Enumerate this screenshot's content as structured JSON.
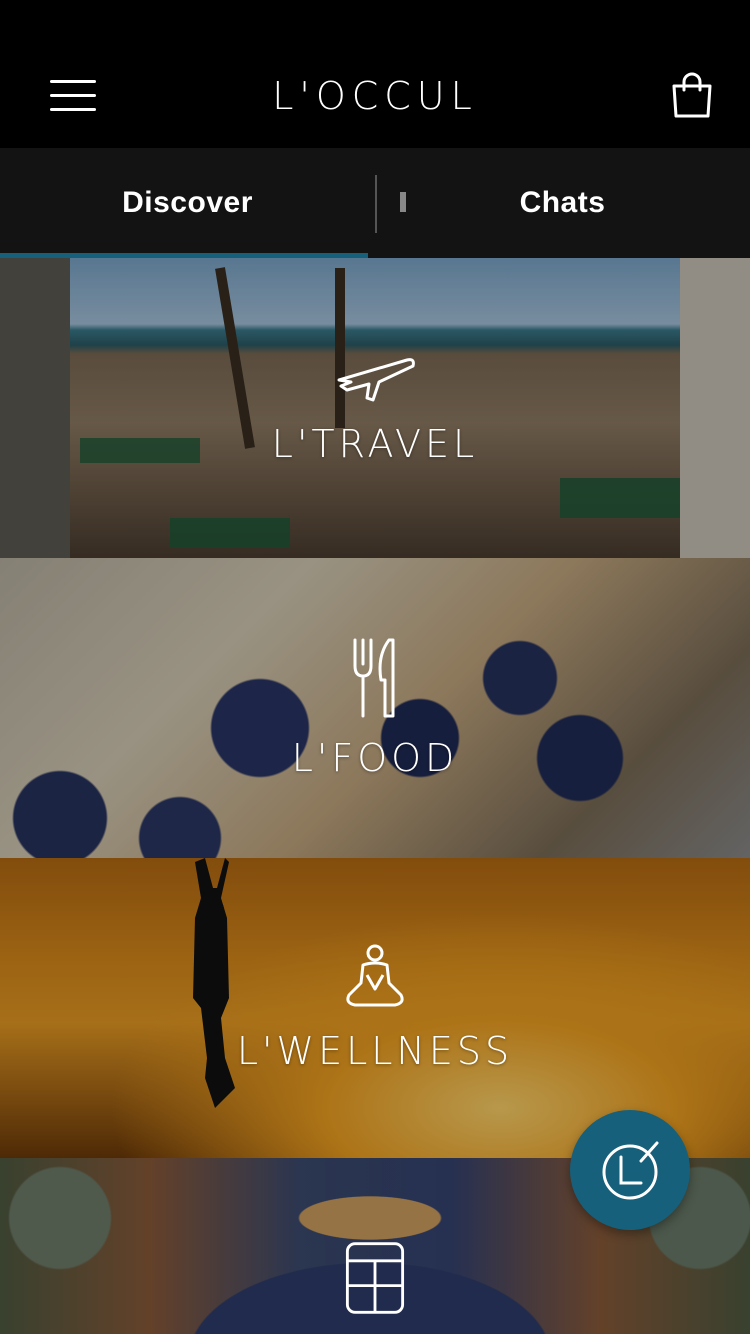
{
  "header": {
    "logo_text": "L'OCCUL",
    "menu_icon": "hamburger-menu-icon",
    "cart_icon": "shopping-bag-icon"
  },
  "tabs": [
    {
      "label": "Discover",
      "active": true
    },
    {
      "label": "Chats",
      "active": false
    }
  ],
  "categories": [
    {
      "title": "L'TRAVEL",
      "icon": "airplane-icon"
    },
    {
      "title": "L'FOOD",
      "icon": "fork-knife-icon"
    },
    {
      "title": "L'WELLNESS",
      "icon": "meditation-icon"
    },
    {
      "title": "",
      "icon": "window-frame-icon"
    }
  ],
  "fab": {
    "icon": "logo-mark-icon"
  },
  "colors": {
    "accent": "#17607b",
    "header_bg": "#000000",
    "tabs_bg": "#131313",
    "text": "#ffffff"
  }
}
